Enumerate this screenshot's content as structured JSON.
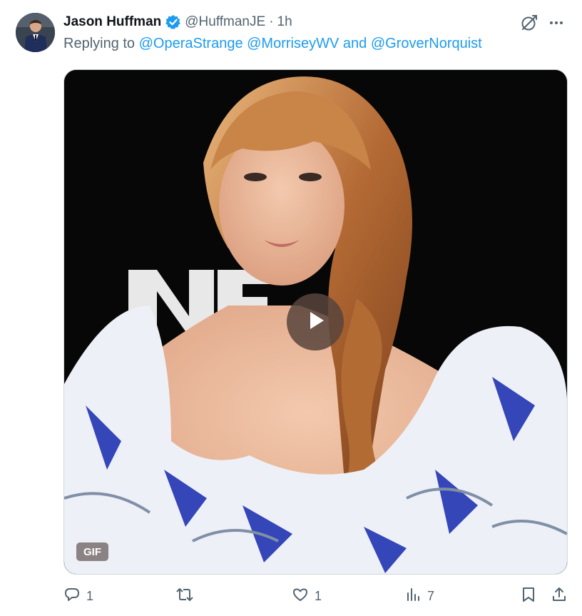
{
  "tweet": {
    "author_name": "Jason Huffman",
    "author_handle": "@HuffmanJE",
    "separator": "·",
    "time": "1h",
    "replying_prefix": "Replying to",
    "mentions": [
      "@OperaStrange",
      "@MorriseyWV",
      "@GroverNorquist"
    ],
    "mention_joiner": "and",
    "media": {
      "badge": "GIF",
      "type": "gif"
    },
    "actions": {
      "replies": "1",
      "reposts": "",
      "likes": "1",
      "views": "7"
    }
  },
  "icons": {
    "verified": "verified-badge-icon",
    "grok": "grok-icon",
    "more": "more-icon",
    "reply": "reply-icon",
    "repost": "repost-icon",
    "like": "like-icon",
    "views": "views-icon",
    "bookmark": "bookmark-icon",
    "share": "share-icon",
    "play": "play-icon"
  },
  "colors": {
    "accent": "#1d9bf0",
    "secondary_text": "#536471",
    "primary_text": "#0f1419"
  }
}
